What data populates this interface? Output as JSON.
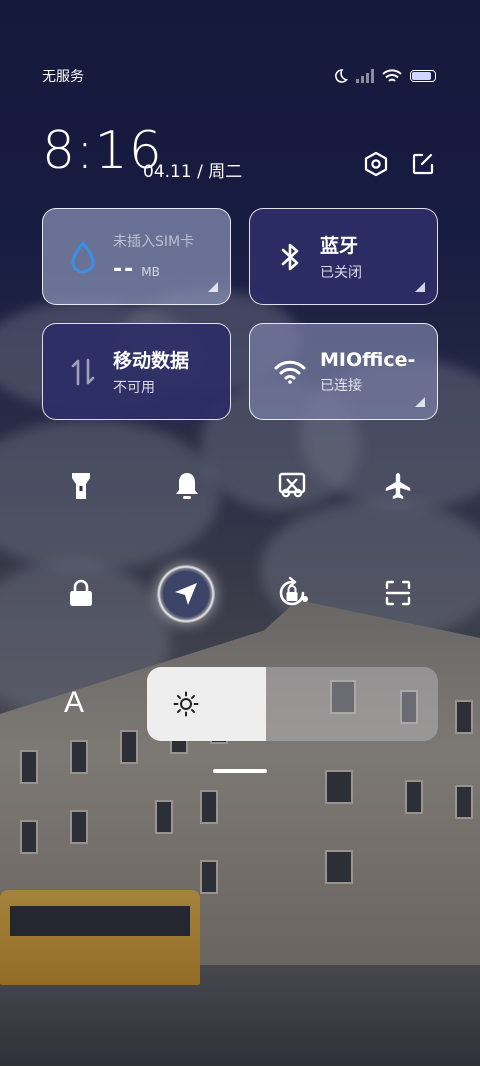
{
  "status_bar": {
    "carrier": "无服务",
    "battery_level": 0.85
  },
  "header": {
    "time": "8:16",
    "date": "04.11 / 周二"
  },
  "tiles": {
    "sim": {
      "label": "未插入SIM卡",
      "value": "--",
      "unit": "MB"
    },
    "bluetooth": {
      "title": "蓝牙",
      "status": "已关闭"
    },
    "mobile_data": {
      "title": "移动数据",
      "status": "不可用"
    },
    "wifi": {
      "title": "MIOffice-",
      "status": "已连接"
    }
  },
  "toggles": [
    {
      "name": "flashlight-icon",
      "active": false
    },
    {
      "name": "bell-icon",
      "active": false
    },
    {
      "name": "screenshot-icon",
      "active": false
    },
    {
      "name": "airplane-icon",
      "active": false
    },
    {
      "name": "lock-icon",
      "active": false
    },
    {
      "name": "location-icon",
      "active": true
    },
    {
      "name": "rotation-lock-icon",
      "active": false
    },
    {
      "name": "scan-icon",
      "active": false
    }
  ],
  "font_button": "A",
  "brightness": {
    "level": 0.41
  },
  "colors": {
    "accent_blue": "#3a8fe8",
    "tile_dark": "#2c2e66"
  }
}
